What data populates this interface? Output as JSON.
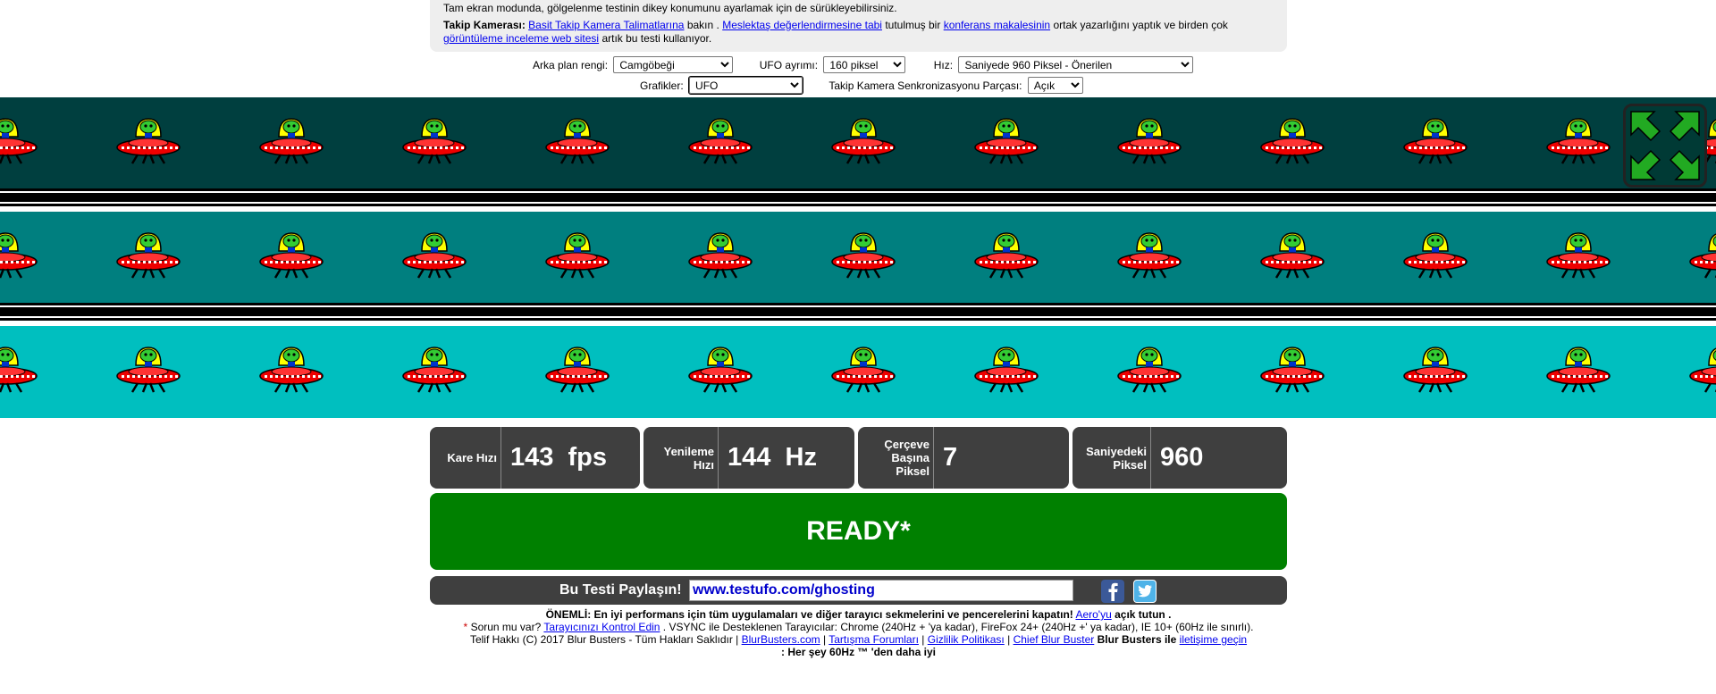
{
  "info": {
    "line1": "Tam ekran modunda, gölgelenme testinin dikey konumunu ayarlamak için de sürükleyebilirsiniz.",
    "camera_bold": "Takip Kamerası:",
    "link_instructions": "Basit Takip Kamera Talimatlarına",
    "text_look": "bakın .",
    "link_peer_review": "Meslektaş değerlendirmesine tabi",
    "text_held": "tutulmuş bir",
    "link_conference": "konferans makalesinin",
    "text_coauthor": "ortak yazarlığını yaptık ve birden çok",
    "link_review_site": "görüntüleme inceleme web sitesi",
    "text_now_uses": "artık bu testi kullanıyor."
  },
  "controls": {
    "background_label": "Arka plan rengi:",
    "background_value": "Camgöbeği",
    "ufo_spacing_label": "UFO ayrımı:",
    "ufo_spacing_value": "160 piksel",
    "speed_label": "Hız:",
    "speed_value": "Saniyede 960 Piksel - Önerilen",
    "graphics_label": "Grafikler:",
    "graphics_value": "UFO",
    "sync_label": "Takip Kamera Senkronizasyonu Parçası:",
    "sync_value": "Açık"
  },
  "tracks": {
    "colors": [
      "#003f3f",
      "#007f7f",
      "#00bfbf"
    ],
    "ufo_icon": "ufo-alien-icon"
  },
  "stats": {
    "fps_label": "Kare Hızı",
    "fps_value": "143  fps",
    "refresh_label": "Yenileme Hızı",
    "refresh_value": "144  Hz",
    "ppf_label": "Çerçeve Başına Piksel",
    "ppf_value": "7",
    "pps_label": "Saniyedeki Piksel",
    "pps_value": "960"
  },
  "ready": {
    "text": "READY*"
  },
  "share": {
    "label": "Bu Testi Paylaşın!",
    "url": "www.testufo.com/ghosting",
    "facebook_icon": "facebook-icon",
    "twitter_icon": "twitter-icon"
  },
  "footer": {
    "important_bold": "ÖNEMLİ: En iyi performans için tüm uygulamaları ve diğer tarayıcı sekmelerini ve pencerelerini kapatın!",
    "aero_link": "Aero'yu",
    "aero_tail": "açık tutun .",
    "asterisk": "*",
    "problem_text": "Sorun mu var?",
    "check_browser_link": "Tarayıcınızı Kontrol Edin",
    "vsync_text": ". VSYNC ile Desteklenen Tarayıcılar: Chrome (240Hz + 'ya kadar), FireFox 24+ (240Hz +' ya kadar), IE 10+ (60Hz ile sınırlı).",
    "copyright": "Telif Hakkı (C) 2017 Blur Busters - Tüm Hakları Saklıdır |",
    "link_blurbusters": "BlurBusters.com",
    "sep1": "|",
    "link_forums": "Tartışma Forumları",
    "sep2": "|",
    "link_privacy": "Gizlilik Politikası",
    "sep3": "|",
    "link_chief": "Chief Blur Buster",
    "bb_bold": "Blur Busters ile",
    "link_contact": "iletişime geçin",
    "tagline": ": Her şey 60Hz ™ 'den daha iyi"
  }
}
